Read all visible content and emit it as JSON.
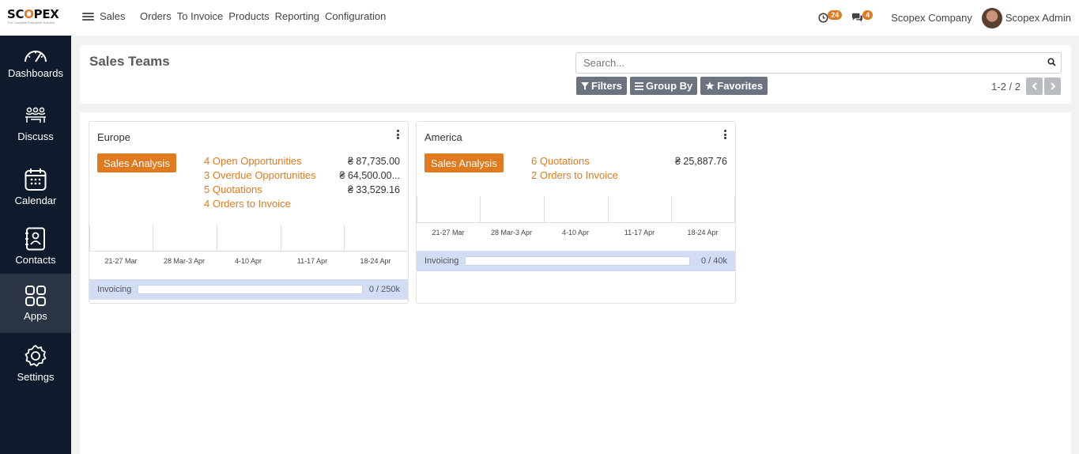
{
  "brand": {
    "name": "SCOPEX",
    "tagline": "The Complete Enterprise Solution",
    "accent": "#e07a1f",
    "sidebar_bg": "#0f1b2d"
  },
  "topbar": {
    "app": "Sales",
    "menu": [
      "Orders",
      "To Invoice",
      "Products",
      "Reporting",
      "Configuration"
    ],
    "activity_count": "24",
    "message_count": "4",
    "company": "Scopex Company",
    "user": "Scopex Admin"
  },
  "sidebar": {
    "items": [
      {
        "label": "Dashboards",
        "icon": "gauge-icon"
      },
      {
        "label": "Discuss",
        "icon": "people-icon"
      },
      {
        "label": "Calendar",
        "icon": "calendar-icon"
      },
      {
        "label": "Contacts",
        "icon": "contact-book-icon"
      },
      {
        "label": "Apps",
        "icon": "grid-icon"
      },
      {
        "label": "Settings",
        "icon": "gear-icon"
      }
    ]
  },
  "control": {
    "title": "Sales Teams",
    "search_placeholder": "Search...",
    "filters_label": "Filters",
    "groupby_label": "Group By",
    "favorites_label": "Favorites",
    "pager": "1-2 / 2"
  },
  "cards": [
    {
      "name": "Europe",
      "button": "Sales Analysis",
      "links": [
        "4 Open Opportunities",
        "3 Overdue Opportunities",
        "5 Quotations",
        "4 Orders to Invoice"
      ],
      "amounts": [
        "₴ 87,735.00",
        "₴ 64,500.00...",
        "₴ 33,529.16"
      ],
      "ticks": [
        "21-27 Mar",
        "28 Mar-3 Apr",
        "4-10 Apr",
        "11-17 Apr",
        "18-24 Apr"
      ],
      "invoicing_label": "Invoicing",
      "invoicing_value": "0 / 250k",
      "invoicing_progress": 0
    },
    {
      "name": "America",
      "button": "Sales Analysis",
      "links": [
        "6 Quotations",
        "2 Orders to Invoice"
      ],
      "amounts": [
        "₴ 25,887.76"
      ],
      "ticks": [
        "21-27 Mar",
        "28 Mar-3 Apr",
        "4-10 Apr",
        "11-17 Apr",
        "18-24 Apr"
      ],
      "invoicing_label": "Invoicing",
      "invoicing_value": "0 / 40k",
      "invoicing_progress": 0
    }
  ]
}
